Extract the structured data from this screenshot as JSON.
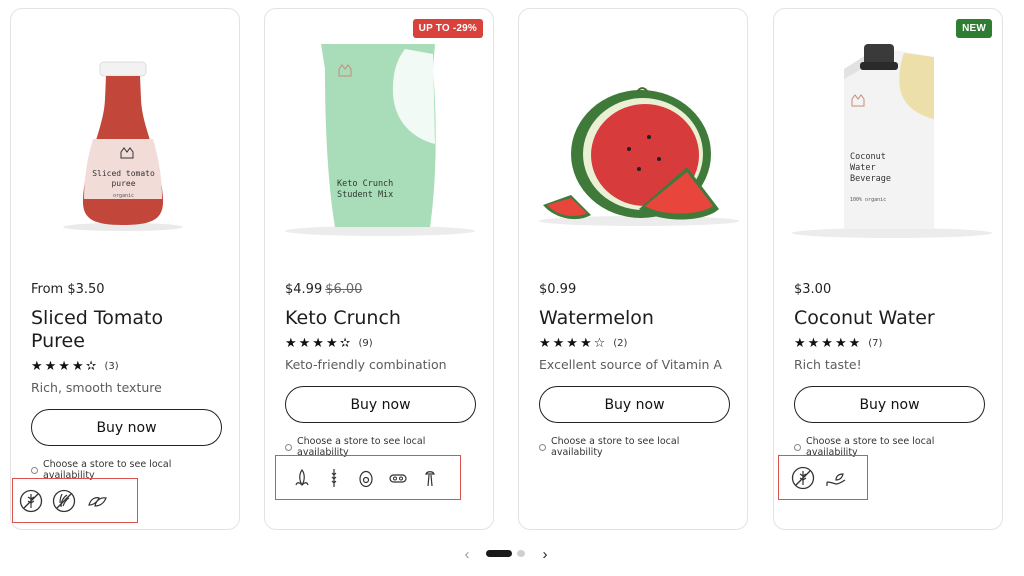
{
  "products": [
    {
      "price": "From $3.50",
      "old_price": "",
      "title": "Sliced Tomato Puree",
      "stars": "★★★★✫",
      "rating_count": "(3)",
      "description": "Rich, smooth texture",
      "buy_label": "Buy now",
      "store_text": "Choose a store to see local availability",
      "package_label": "Sliced tomato puree",
      "package_sublabel": "organic",
      "diet_icons": [
        "gluten-free-icon",
        "wheat-free-icon",
        "vegan-leaf-icon"
      ]
    },
    {
      "price": "$4.99",
      "old_price": "$6.00",
      "title": "Keto Crunch",
      "stars": "★★★★✫",
      "rating_count": "(9)",
      "description": "Keto-friendly combination",
      "buy_label": "Buy now",
      "store_text": "Choose a store to see local availability",
      "badge": "UP TO -29%",
      "badge_color": "#d9413b",
      "package_label": "Keto Crunch Student Mix",
      "diet_icons": [
        "corn-icon",
        "wheat-icon",
        "egg-icon",
        "soy-icon",
        "celery-icon"
      ]
    },
    {
      "price": "$0.99",
      "old_price": "",
      "title": "Watermelon",
      "stars": "★★★★☆",
      "rating_count": "(2)",
      "description": "Excellent source of Vitamin A",
      "buy_label": "Buy now",
      "store_text": "Choose a store to see local availability",
      "diet_icons": []
    },
    {
      "price": "$3.00",
      "old_price": "",
      "title": "Coconut Water",
      "stars": "★★★★★",
      "rating_count": "(7)",
      "description": "Rich taste!",
      "buy_label": "Buy now",
      "store_text": "Choose a store to see local availability",
      "badge": "NEW",
      "badge_color": "#2e7d32",
      "package_label": "Coconut Water Beverage",
      "package_sublabel": "100% organic",
      "diet_icons": [
        "gluten-free-icon",
        "hand-leaf-icon"
      ]
    }
  ],
  "pagination": {
    "prev_icon": "‹",
    "next_icon": "›",
    "pages": 2,
    "current": 1
  },
  "colors": {
    "highlight_box": "#d9534f",
    "text": "#222222"
  }
}
